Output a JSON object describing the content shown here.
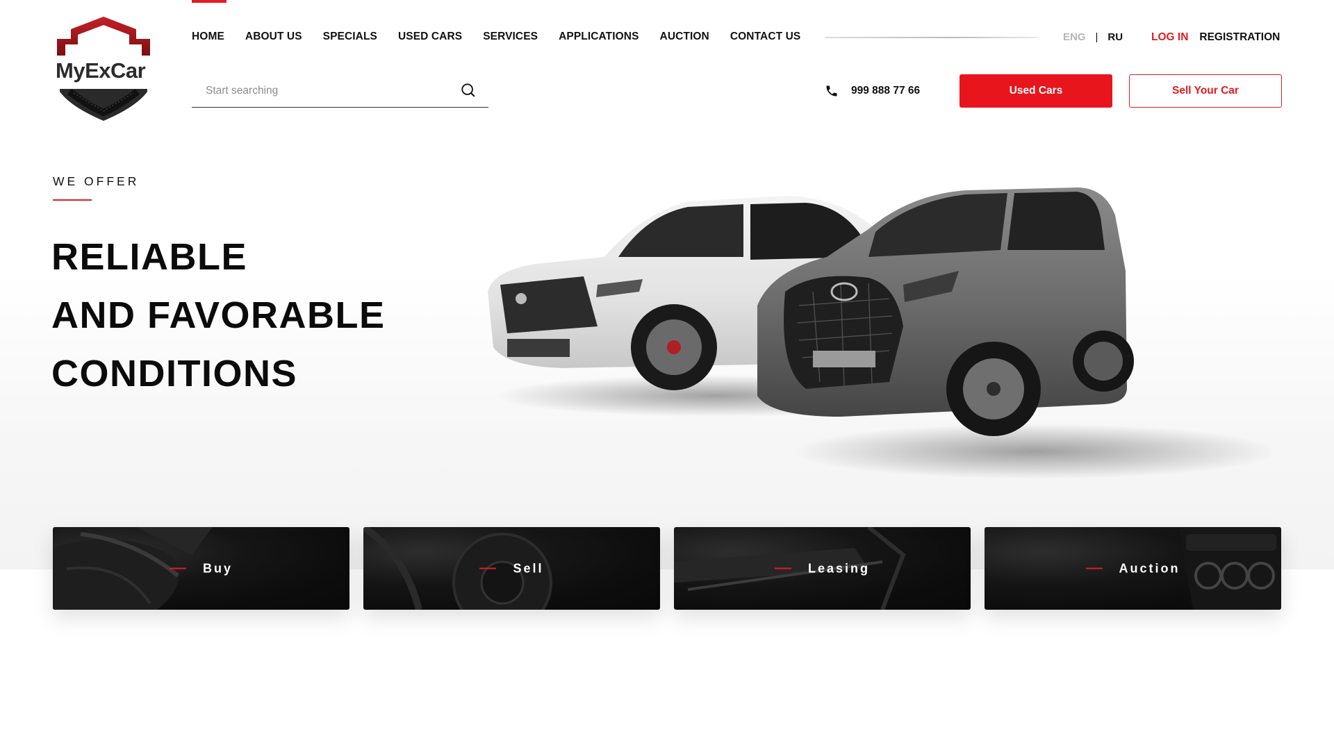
{
  "brand": {
    "logo_text": "MyExCar",
    "accent": "#e31b23"
  },
  "nav": {
    "items": [
      {
        "label": "HOME",
        "active": true
      },
      {
        "label": "ABOUT US"
      },
      {
        "label": "SPECIALS"
      },
      {
        "label": "USED CARS"
      },
      {
        "label": "SERVICES"
      },
      {
        "label": "APPLICATIONS"
      },
      {
        "label": "AUCTION"
      },
      {
        "label": "CONTACT US"
      }
    ]
  },
  "lang": {
    "eng": "ENG",
    "sep": "|",
    "ru": "RU",
    "selected": "RU"
  },
  "auth": {
    "login": "LOG IN",
    "register": "REGISTRATION"
  },
  "search": {
    "placeholder": "Start searching",
    "icon": "search-icon"
  },
  "phone": {
    "number": "999 888 77 66",
    "icon": "phone-icon"
  },
  "buttons": {
    "used_cars": "Used Cars",
    "sell_car": "Sell Your Car"
  },
  "hero": {
    "eyebrow": "WE OFFER",
    "headline": [
      "RELIABLE",
      "AND FAVORABLE",
      "CONDITIONS"
    ]
  },
  "cards": [
    {
      "label": "Buy"
    },
    {
      "label": "Sell"
    },
    {
      "label": "Leasing"
    },
    {
      "label": "Auction"
    }
  ]
}
